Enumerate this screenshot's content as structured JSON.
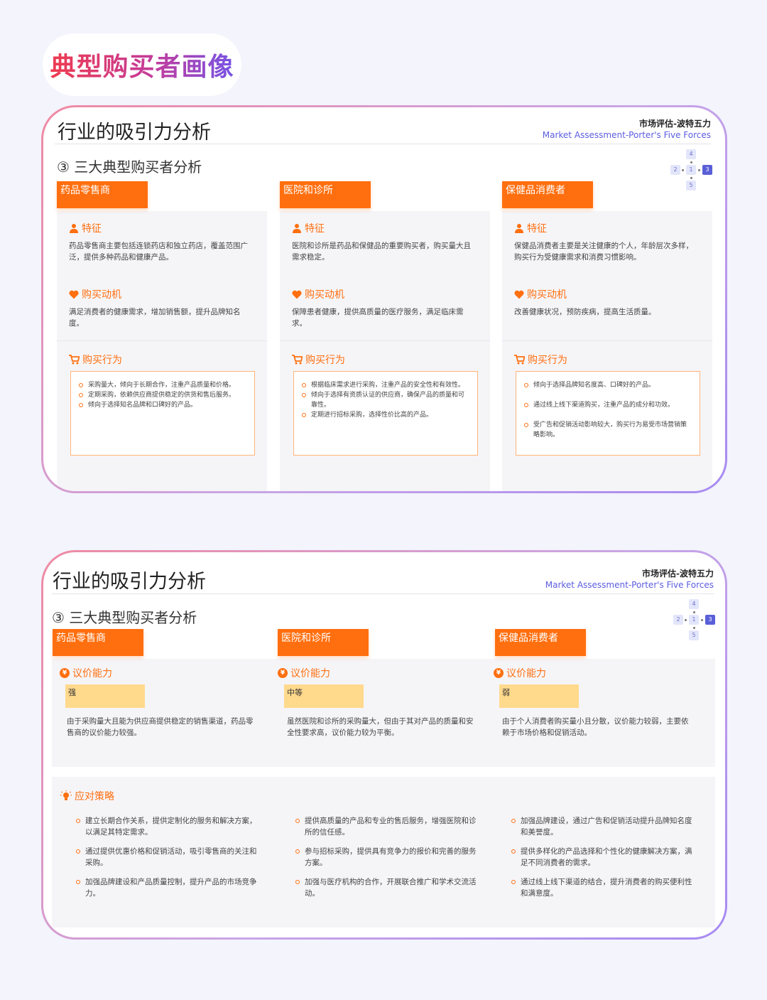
{
  "page_title": "典型购买者画像",
  "brand": {
    "cn": "市场评估-波特五力",
    "en": "Market Assessment-Porter's Five Forces"
  },
  "nav": [
    "4",
    "2",
    "1",
    "3",
    "5"
  ],
  "slide1": {
    "title": "行业的吸引力分析",
    "section": "③ 三大典型购买者分析",
    "columns": [
      {
        "tab": "药品零售商",
        "feature_head": "特征",
        "feature": "药品零售商主要包括连锁药店和独立药店，覆盖范围广泛，提供多种药品和健康产品。",
        "motive_head": "购买动机",
        "motive": "满足消费者的健康需求，增加销售额，提升品牌知名度。",
        "behavior_head": "购买行为",
        "behavior": [
          "采购量大，倾向于长期合作，注重产品质量和价格。",
          "定期采购，依赖供应商提供稳定的供货和售后服务。",
          "倾向于选择知名品牌和口碑好的产品。"
        ]
      },
      {
        "tab": "医院和诊所",
        "feature_head": "特征",
        "feature": "医院和诊所是药品和保健品的重要购买者，购买量大且需求稳定。",
        "motive_head": "购买动机",
        "motive": "保障患者健康，提供高质量的医疗服务，满足临床需求。",
        "behavior_head": "购买行为",
        "behavior": [
          "根据临床需求进行采购，注重产品的安全性和有效性。",
          "倾向于选择有资质认证的供应商，确保产品的质量和可靠性。",
          "定期进行招标采购，选择性价比高的产品。"
        ]
      },
      {
        "tab": "保健品消费者",
        "feature_head": "特征",
        "feature": "保健品消费者主要是关注健康的个人，年龄层次多样，购买行为受健康需求和消费习惯影响。",
        "motive_head": "购买动机",
        "motive": "改善健康状况，预防疾病，提高生活质量。",
        "behavior_head": "购买行为",
        "behavior": [
          "倾向于选择品牌知名度高、口碑好的产品。",
          "通过线上线下渠道购买，注重产品的成分和功效。",
          "受广告和促销活动影响较大，购买行为易受市场营销策略影响。"
        ]
      }
    ]
  },
  "slide2": {
    "title": "行业的吸引力分析",
    "section": "③ 三大典型购买者分析",
    "columns": [
      {
        "tab": "药品零售商",
        "power_head": "议价能力",
        "level": "强",
        "power": "由于采购量大且能为供应商提供稳定的销售渠道，药品零售商的议价能力较强。"
      },
      {
        "tab": "医院和诊所",
        "power_head": "议价能力",
        "level": "中等",
        "power": "虽然医院和诊所的采购量大，但由于其对产品的质量和安全性要求高，议价能力较为平衡。"
      },
      {
        "tab": "保健品消费者",
        "power_head": "议价能力",
        "level": "弱",
        "power": "由于个人消费者购买量小且分散，议价能力较弱，主要依赖于市场价格和促销活动。"
      }
    ],
    "strategy_head": "应对策略",
    "strategies": [
      [
        "建立长期合作关系，提供定制化的服务和解决方案，以满足其特定需求。",
        "通过提供优惠价格和促销活动，吸引零售商的关注和采购。",
        "加强品牌建设和产品质量控制，提升产品的市场竞争力。"
      ],
      [
        "提供高质量的产品和专业的售后服务，增强医院和诊所的信任感。",
        "参与招标采购，提供具有竞争力的报价和完善的服务方案。",
        "加强与医疗机构的合作，开展联合推广和学术交流活动。"
      ],
      [
        "加强品牌建设，通过广告和促销活动提升品牌知名度和美誉度。",
        "提供多样化的产品选择和个性化的健康解决方案，满足不同消费者的需求。",
        "通过线上线下渠道的结合，提升消费者的购买便利性和满意度。"
      ]
    ]
  },
  "colors": {
    "accent": "#ff6f0f",
    "brand_blue": "#5b5ce0",
    "level_fill": "#ffd98c",
    "card_bg": "#f5f5f8"
  }
}
